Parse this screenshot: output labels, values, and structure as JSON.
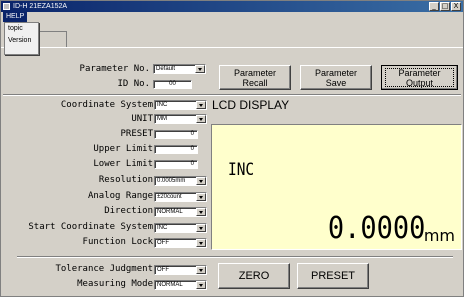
{
  "window": {
    "title": "ID-H 21EZA152A",
    "min": "_",
    "max": "□",
    "close": "X"
  },
  "menu": {
    "help": "HELP",
    "items": [
      "topic",
      "Version"
    ]
  },
  "params": {
    "parameter_no_label": "Parameter No.",
    "parameter_no_value": "Default",
    "id_no_label": "ID No.",
    "id_no_value": "00"
  },
  "buttons": {
    "recall": [
      "Parameter",
      "Recall"
    ],
    "save": [
      "Parameter",
      "Save"
    ],
    "output": [
      "Parameter",
      "Output"
    ],
    "zero": "ZERO",
    "preset": "PRESET"
  },
  "settings": {
    "coordinate_system": {
      "label": "Coordinate System",
      "value": "INC"
    },
    "unit": {
      "label": "UNIT",
      "value": "MM"
    },
    "preset": {
      "label": "PRESET",
      "value": "0"
    },
    "upper_limit": {
      "label": "Upper Limit",
      "value": "0"
    },
    "lower_limit": {
      "label": "Lower Limit",
      "value": "0"
    },
    "resolution": {
      "label": "Resolution",
      "value": "0.0005mm"
    },
    "analog_range": {
      "label": "Analog Range",
      "value": "±20count"
    },
    "direction": {
      "label": "Direction",
      "value": "NORMAL"
    },
    "start_coordinate_system": {
      "label": "Start Coordinate System",
      "value": "INC"
    },
    "function_lock": {
      "label": "Function Lock",
      "value": "OFF"
    },
    "tolerance_judgment": {
      "label": "Tolerance Judgment",
      "value": "OFF"
    },
    "measuring_mode": {
      "label": "Measuring Mode",
      "value": "NORMAL"
    }
  },
  "lcd": {
    "title": "LCD DISPLAY",
    "mode": "INC",
    "value": "0.0000",
    "unit": "mm",
    "background": "#ffffcc"
  }
}
